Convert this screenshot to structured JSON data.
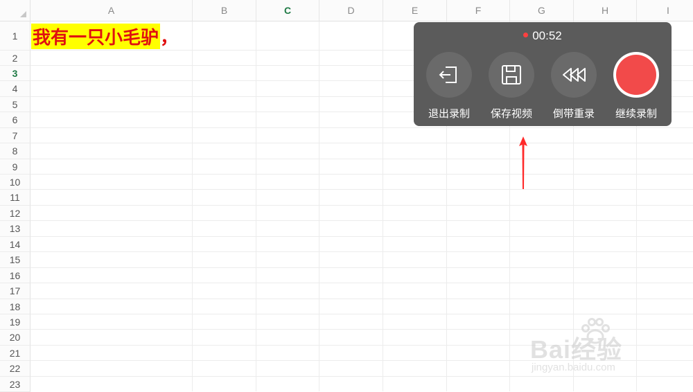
{
  "columns": [
    "A",
    "B",
    "C",
    "D",
    "E",
    "F",
    "G",
    "H",
    "I"
  ],
  "active_column": "C",
  "rows": [
    "1",
    "2",
    "3",
    "4",
    "5",
    "6",
    "7",
    "8",
    "9",
    "10",
    "11",
    "12",
    "13",
    "14",
    "15",
    "16",
    "17",
    "18",
    "19",
    "20",
    "21",
    "22",
    "23"
  ],
  "active_row": "3",
  "cell_a1": {
    "text": "我有一只小毛驴",
    "tail": "，",
    "text_color": "#e01010",
    "highlight_color": "#ffff00"
  },
  "recording_panel": {
    "timer": "00:52",
    "buttons": [
      {
        "label": "退出录制",
        "icon": "exit-icon"
      },
      {
        "label": "保存视频",
        "icon": "save-icon"
      },
      {
        "label": "倒带重录",
        "icon": "rewind-icon"
      },
      {
        "label": "继续录制",
        "icon": "record-icon"
      }
    ]
  },
  "watermark": {
    "brand": "Bai经验",
    "site": "jingyan.baidu.com"
  }
}
